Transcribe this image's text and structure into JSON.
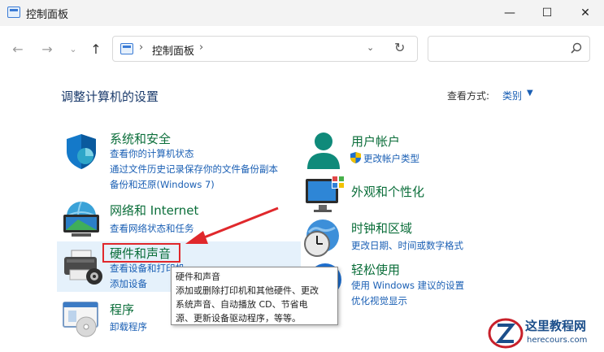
{
  "window": {
    "title": "控制面板",
    "minimize": "—",
    "maximize": "☐",
    "close": "✕"
  },
  "nav": {
    "back": "←",
    "forward": "→",
    "dropdown": "⌄",
    "up": "↑",
    "address_sep1": "›",
    "address_text": "控制面板",
    "address_sep2": "›",
    "address_dropdown": "⌄",
    "refresh": "↻",
    "search_placeholder": ""
  },
  "page": {
    "heading": "调整计算机的设置",
    "view_label": "查看方式:",
    "view_value": "类别",
    "view_caret": "▼"
  },
  "categories_left": [
    {
      "title": "系统和安全",
      "icon": "shield-icon",
      "links": [
        "查看你的计算机状态",
        "通过文件历史记录保存你的文件备份副本",
        "备份和还原(Windows 7)"
      ]
    },
    {
      "title": "网络和 Internet",
      "icon": "network-icon",
      "links": [
        "查看网络状态和任务"
      ]
    },
    {
      "title": "硬件和声音",
      "icon": "printer-icon",
      "links": [
        "查看设备和打印机",
        "添加设备"
      ]
    },
    {
      "title": "程序",
      "icon": "programs-icon",
      "links": [
        "卸载程序"
      ]
    }
  ],
  "categories_right": [
    {
      "title": "用户帐户",
      "icon": "user-icon",
      "links": [
        "更改帐户类型"
      ]
    },
    {
      "title": "外观和个性化",
      "icon": "appearance-icon",
      "links": []
    },
    {
      "title": "时钟和区域",
      "icon": "clock-icon",
      "links": [
        "更改日期、时间或数字格式"
      ]
    },
    {
      "title": "轻松使用",
      "icon": "accessibility-icon",
      "links": [
        "使用 Windows 建议的设置",
        "优化视觉显示"
      ]
    }
  ],
  "tooltip": {
    "lines": [
      "硬件和声音",
      "添加或删除打印机和其他硬件、更改",
      "系统声音、自动播放 CD、节省电",
      "源、更新设备驱动程序，等等。"
    ]
  },
  "watermark": {
    "title": "这里教程网",
    "url": "herecours.com"
  },
  "colors": {
    "title_green": "#0b6e3a",
    "link_blue": "#1a5fb4",
    "highlight": "#e5f1fb",
    "annotation_red": "#e0282c"
  }
}
